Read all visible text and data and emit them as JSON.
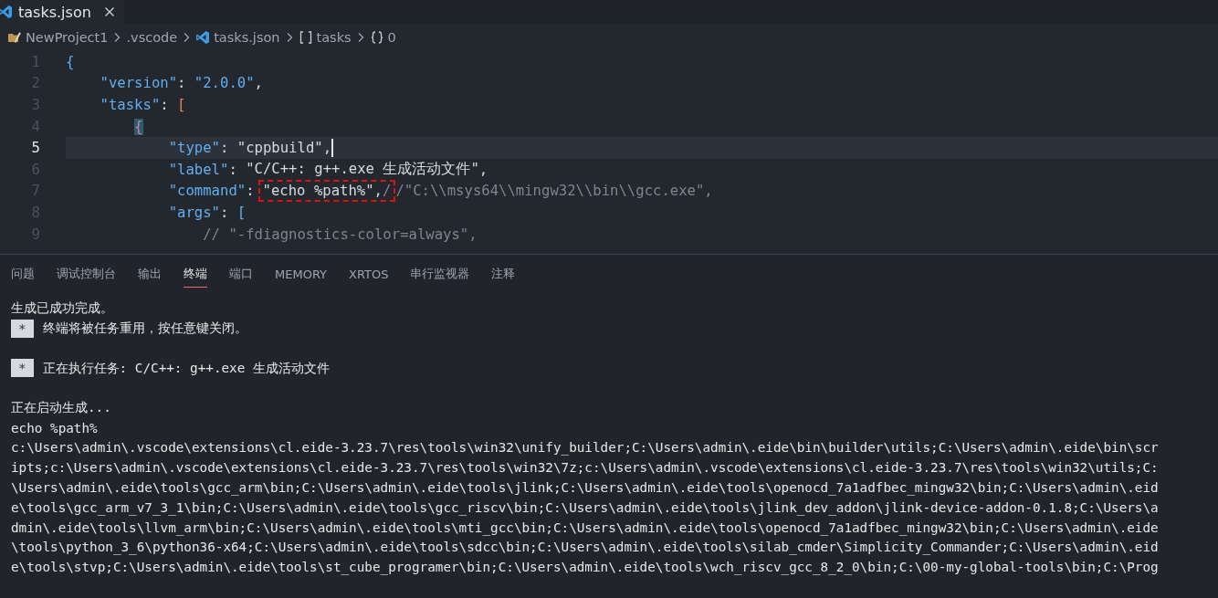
{
  "editor_tabs": [
    {
      "label": "tasks.json",
      "selected": true
    }
  ],
  "breadcrumb": [
    {
      "kind": "folder",
      "text": "NewProject1"
    },
    {
      "kind": "plain",
      "text": ".vscode"
    },
    {
      "kind": "file",
      "text": "tasks.json"
    },
    {
      "kind": "array",
      "text": "tasks"
    },
    {
      "kind": "object",
      "text": "0"
    }
  ],
  "code_lines": [
    {
      "number": "1",
      "current": false,
      "tokens": [
        {
          "kind": "accent",
          "text": "{"
        }
      ]
    },
    {
      "number": "2",
      "current": false,
      "tokens": [
        {
          "kind": "accent",
          "text": "    \"version\""
        },
        {
          "kind": "punct",
          "text": ": "
        },
        {
          "kind": "accent",
          "text": "\"2.0.0\""
        },
        {
          "kind": "punct",
          "text": ","
        }
      ]
    },
    {
      "number": "3",
      "current": false,
      "tokens": [
        {
          "kind": "accent",
          "text": "    \"tasks\""
        },
        {
          "kind": "punct",
          "text": ": "
        },
        {
          "kind": "bracket",
          "text": "["
        }
      ]
    },
    {
      "number": "4",
      "current": false,
      "tokens": [
        {
          "kind": "brace",
          "text": "        {"
        }
      ]
    },
    {
      "number": "5",
      "current": true,
      "tokens": [
        {
          "kind": "accent",
          "text": "            \"type\""
        },
        {
          "kind": "punct",
          "text": ": "
        },
        {
          "kind": "plain",
          "text": "\"cppbuild\""
        },
        {
          "kind": "punct",
          "text": ","
        }
      ]
    },
    {
      "number": "6",
      "current": false,
      "tokens": [
        {
          "kind": "accent",
          "text": "            \"label\""
        },
        {
          "kind": "punct",
          "text": ": "
        },
        {
          "kind": "plain",
          "text": "\"C/C++: g++.exe 生成活动文件\""
        },
        {
          "kind": "punct",
          "text": ","
        }
      ]
    },
    {
      "number": "7",
      "current": false,
      "tokens": [
        {
          "kind": "accent",
          "text": "            \"command\""
        },
        {
          "kind": "punct",
          "text": ":"
        },
        {
          "kind": "box",
          "children": [
            {
              "kind": "plain",
              "text": "\"echo %path%\""
            },
            {
              "kind": "punct",
              "text": ","
            },
            {
              "kind": "comment",
              "text": "/"
            }
          ]
        },
        {
          "kind": "comment",
          "text": "/\"C:\\\\msys64\\\\mingw32\\\\bin\\\\gcc.exe\","
        }
      ]
    },
    {
      "number": "8",
      "current": false,
      "tokens": [
        {
          "kind": "accent",
          "text": "            \"args\""
        },
        {
          "kind": "punct",
          "text": ": "
        },
        {
          "kind": "accent",
          "text": "["
        }
      ]
    },
    {
      "number": "9",
      "current": false,
      "tokens": [
        {
          "kind": "comment",
          "text": "                // \"-fdiagnostics-color=always\","
        }
      ]
    }
  ],
  "panel_tabs": [
    {
      "label": "问题",
      "selected": false
    },
    {
      "label": "调试控制台",
      "selected": false
    },
    {
      "label": "输出",
      "selected": false
    },
    {
      "label": "终端",
      "selected": true
    },
    {
      "label": "端口",
      "selected": false
    },
    {
      "label": "MEMORY",
      "selected": false
    },
    {
      "label": "XRTOS",
      "selected": false
    },
    {
      "label": "串行监视器",
      "selected": false
    },
    {
      "label": "注释",
      "selected": false
    }
  ],
  "terminal_lines": [
    {
      "kind": "text",
      "text": "生成已成功完成。"
    },
    {
      "kind": "badge",
      "badge": "*",
      "text": "终端将被任务重用，按任意键关闭。"
    },
    {
      "kind": "blank"
    },
    {
      "kind": "badge",
      "badge": "*",
      "text": "正在执行任务: C/C++: g++.exe 生成活动文件"
    },
    {
      "kind": "blank"
    },
    {
      "kind": "text",
      "text": "正在启动生成..."
    },
    {
      "kind": "text",
      "text": "echo %path%"
    },
    {
      "kind": "text",
      "text": "c:\\Users\\admin\\.vscode\\extensions\\cl.eide-3.23.7\\res\\tools\\win32\\unify_builder;C:\\Users\\admin\\.eide\\bin\\builder\\utils;C:\\Users\\admin\\.eide\\bin\\scr"
    },
    {
      "kind": "text",
      "text": "ipts;c:\\Users\\admin\\.vscode\\extensions\\cl.eide-3.23.7\\res\\tools\\win32\\7z;c:\\Users\\admin\\.vscode\\extensions\\cl.eide-3.23.7\\res\\tools\\win32\\utils;C:"
    },
    {
      "kind": "text",
      "text": "\\Users\\admin\\.eide\\tools\\gcc_arm\\bin;C:\\Users\\admin\\.eide\\tools\\jlink;C:\\Users\\admin\\.eide\\tools\\openocd_7a1adfbec_mingw32\\bin;C:\\Users\\admin\\.eid"
    },
    {
      "kind": "text",
      "text": "e\\tools\\gcc_arm_v7_3_1\\bin;C:\\Users\\admin\\.eide\\tools\\gcc_riscv\\bin;C:\\Users\\admin\\.eide\\tools\\jlink_dev_addon\\jlink-device-addon-0.1.8;C:\\Users\\a"
    },
    {
      "kind": "text",
      "text": "dmin\\.eide\\tools\\llvm_arm\\bin;C:\\Users\\admin\\.eide\\tools\\mti_gcc\\bin;C:\\Users\\admin\\.eide\\tools\\openocd_7a1adfbec_mingw32\\bin;C:\\Users\\admin\\.eide"
    },
    {
      "kind": "text",
      "text": "\\tools\\python_3_6\\python36-x64;C:\\Users\\admin\\.eide\\tools\\sdcc\\bin;C:\\Users\\admin\\.eide\\tools\\silab_cmder\\Simplicity_Commander;C:\\Users\\admin\\.eid"
    },
    {
      "kind": "text",
      "text": "e\\tools\\stvp;C:\\Users\\admin\\.eide\\tools\\st_cube_programer\\bin;C:\\Users\\admin\\.eide\\tools\\wch_riscv_gcc_8_2_0\\bin;C:\\00-my-global-tools\\bin;C:\\Prog"
    }
  ]
}
